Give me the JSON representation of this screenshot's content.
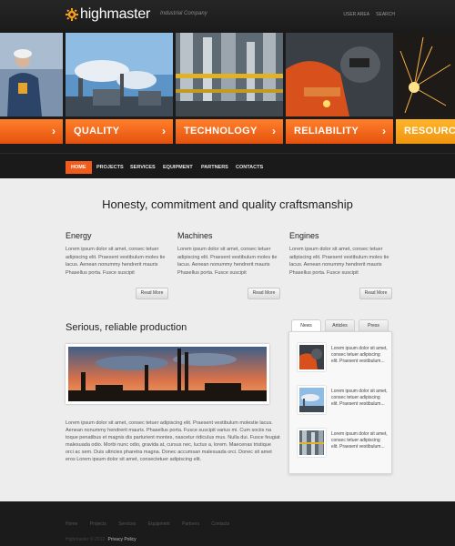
{
  "header": {
    "logo": "highmaster",
    "tagline": "Industrial Company",
    "links": [
      "User area",
      "Search"
    ]
  },
  "features": [
    {
      "label": "QUALITY",
      "color": "#f15b1c"
    },
    {
      "label": "TECHNOLOGY",
      "color": "#f15b1c"
    },
    {
      "label": "RELIABILITY",
      "color": "#f15b1c"
    },
    {
      "label": "RESOURCES",
      "color": "#f5a11b"
    }
  ],
  "nav": [
    "HOME",
    "PROJECTS",
    "SERVICES",
    "EQUIPMENT",
    "PARTNERS",
    "CONTACTS"
  ],
  "main": {
    "headline": "Honesty, commitment and quality craftsmanship",
    "columns": [
      {
        "title": "Energy",
        "text": "Lorem ipsum dolor sit amet, consec tetuer adipiscing elit. Praesent vestibulum moles tie lacus. Aenean nonummy hendrerit mauris Phasellus porta. Fusce suscipit"
      },
      {
        "title": "Machines",
        "text": "Lorem ipsum dolor sit amet, consec tetuer adipiscing elit. Praesent vestibulum moles tie lacus. Aenean nonummy hendrerit mauris Phasellus porta. Fusce suscipit"
      },
      {
        "title": "Engines",
        "text": "Lorem ipsum dolor sit amet, consec tetuer adipiscing elit. Praesent vestibulum moles tie lacus. Aenean nonummy hendrerit mauris Phasellus porta. Fusce suscipit"
      }
    ],
    "read_more": "Read More",
    "sub_headline": "Serious, reliable production",
    "production_text": "Lorem ipsum dolor sit amet, consec tetuer adipiscing elit. Praesent vestibulum molestie lacus. Aenean nonummy hendrerit mauris. Phasellus porta. Fusce suscipit varius mi. Cum sociis na toque penatibus et magnis dis parturient montes, nascetur ridiculus mus. Nulla dui. Fusce feugiat malesuada odio. Morbi nunc odio, gravida at, cursus nec, luctus a, lorem. Maecenas tristique orci ac sem. Duis ultricies pharetra magna. Donec accumsan malesuada orci. Donec sit amet eros Lorem ipsum dolor sit amet, consectetuer adipiscing elit."
  },
  "tabs": {
    "labels": [
      "News",
      "Articles",
      "Press"
    ],
    "items": [
      {
        "text": "Lorem ipsum dolor sit amet, consec tetuer adipiscing elit. Praesent vestibulum..."
      },
      {
        "text": "Lorem ipsum dolor sit amet, consec tetuer adipiscing elit. Praesent vestibulum..."
      },
      {
        "text": "Lorem ipsum dolor sit amet, consec tetuer adipiscing elit. Praesent vestibulum..."
      }
    ]
  },
  "footer": {
    "links": [
      "Home",
      "Projects",
      "Services",
      "Equipment",
      "Partners",
      "Contacts"
    ],
    "copyright": "Highmaster © 2012",
    "privacy": "Privacy Policy"
  }
}
